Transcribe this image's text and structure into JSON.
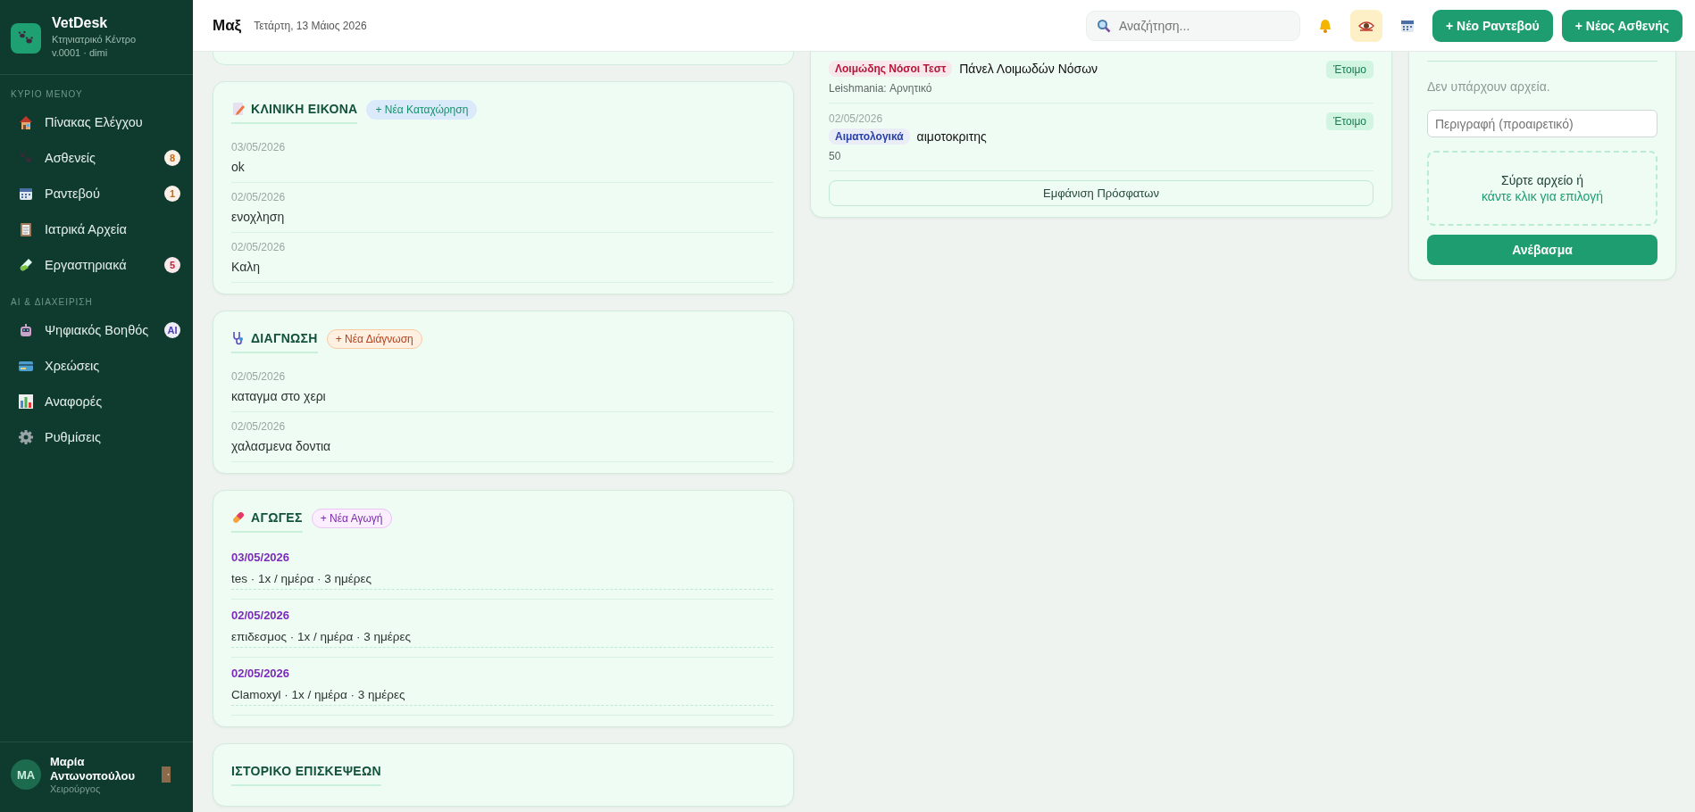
{
  "sidebar": {
    "brand": {
      "name": "VetDesk",
      "subtitle": "Κτηνιατρικό Κέντρο",
      "version": "v.0001 · dimi"
    },
    "sections": [
      {
        "title": "ΚΥΡΙΟ ΜΕΝΟΥ",
        "items": [
          {
            "label": "Πίνακας Ελέγχου"
          },
          {
            "label": "Ασθενείς",
            "badge": "8",
            "color": "#c46a12"
          },
          {
            "label": "Ραντεβού",
            "badge": "1",
            "color": "#c46a12"
          },
          {
            "label": "Ιατρικά Αρχεία"
          },
          {
            "label": "Εργαστηριακά",
            "badge": "5",
            "color": "#c0233a"
          }
        ]
      },
      {
        "title": "AI & ΔΙΑΧΕΙΡΙΣΗ",
        "items": [
          {
            "label": "Ψηφιακός Βοηθός",
            "badge": "AI",
            "color": "#4b3fb0"
          },
          {
            "label": "Χρεώσεις"
          },
          {
            "label": "Αναφορές"
          },
          {
            "label": "Ρυθμίσεις"
          }
        ]
      }
    ],
    "user": {
      "initials": "MA",
      "name": "Μαρία Αντωνοπούλου",
      "role": "Χειρούργος"
    }
  },
  "header": {
    "title": "Μαξ",
    "date": "Τετάρτη, 13 Μάιος 2026",
    "search_placeholder": "Αναζήτηση...",
    "eye_toggle": {
      "on": true
    },
    "buttons": [
      "+ Νέο Ραντεβού",
      "+ Νέος Ασθενής"
    ]
  },
  "notes": [
    {
      "kind": "clinical",
      "title": "ΚΛΙΝΙΚΗ ΕΙΚΟΝΑ",
      "add_button": "+ Νέα Καταχώρηση",
      "entries": [
        {
          "date": "03/05/2026",
          "text": "ok"
        },
        {
          "date": "02/05/2026",
          "text": "ενοχληση"
        },
        {
          "date": "02/05/2026",
          "text": "Καλη"
        }
      ]
    },
    {
      "kind": "diagnosis",
      "title": "ΔΙΑΓΝΩΣΗ",
      "add_button": "+ Νέα Διάγνωση",
      "entries": [
        {
          "date": "02/05/2026",
          "text": "καταγμα στο χερι"
        },
        {
          "date": "02/05/2026",
          "text": "χαλασμενα δοντια"
        }
      ]
    },
    {
      "kind": "treatment",
      "title": "ΑΓΩΓΕΣ",
      "add_button": "+ Νέα Αγωγή",
      "entries": [
        {
          "date": "03/05/2026",
          "text": "tes · 1x / ημέρα · 3 ημέρες"
        },
        {
          "date": "02/05/2026",
          "text": "επιδεσμος · 1x / ημέρα · 3 ημέρες"
        },
        {
          "date": "02/05/2026",
          "text": "Clamoxyl · 1x / ημέρα · 3 ημέρες"
        }
      ]
    },
    {
      "kind": "history",
      "title": "ΙΣΤΟΡΙΚΟ ΕΠΙΣΚΕΨΕΩΝ"
    }
  ],
  "labs": {
    "rows": [
      {
        "tag": "Λοιμώδης Νόσοι Τεστ",
        "color": "#b3173a",
        "name": "Πάνελ Λοιμωδών Νόσων",
        "result": "Leishmania: Αρνητικό",
        "status": "Έτοιμο"
      },
      {
        "date": "02/05/2026",
        "tag": "Αιματολογικά",
        "color": "#2941a8",
        "name": "αιμοτοκριτης",
        "result": "50",
        "status": "Έτοιμο"
      }
    ],
    "show_recent": "Εμφάνιση Πρόσφατων"
  },
  "files": {
    "empty_text": "Δεν υπάρχουν αρχεία.",
    "description_placeholder": "Περιγραφή (προαιρετικό)",
    "drop_text": "Σύρτε αρχείο ή",
    "drop_link": "κάντε κλικ για επιλογή",
    "upload_button": "Ανέβασμα"
  }
}
